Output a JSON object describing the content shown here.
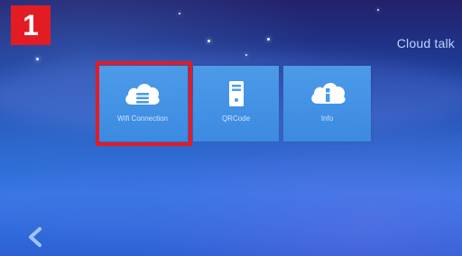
{
  "step_badge": "1",
  "header": {
    "title": "Cloud talk"
  },
  "tiles": [
    {
      "label": "Wifi Connection",
      "icon": "cloud-menu-icon",
      "selected": true
    },
    {
      "label": "QRCode",
      "icon": "server-tower-icon",
      "selected": false
    },
    {
      "label": "Info",
      "icon": "cloud-info-icon",
      "selected": false
    }
  ],
  "navigation": {
    "back_icon": "chevron-left-icon"
  },
  "colors": {
    "badge_red": "#e31c24",
    "tile_blue": "#4aa0ec",
    "title_text": "#b8d4ff",
    "back_arrow": "#9fc4ff"
  }
}
